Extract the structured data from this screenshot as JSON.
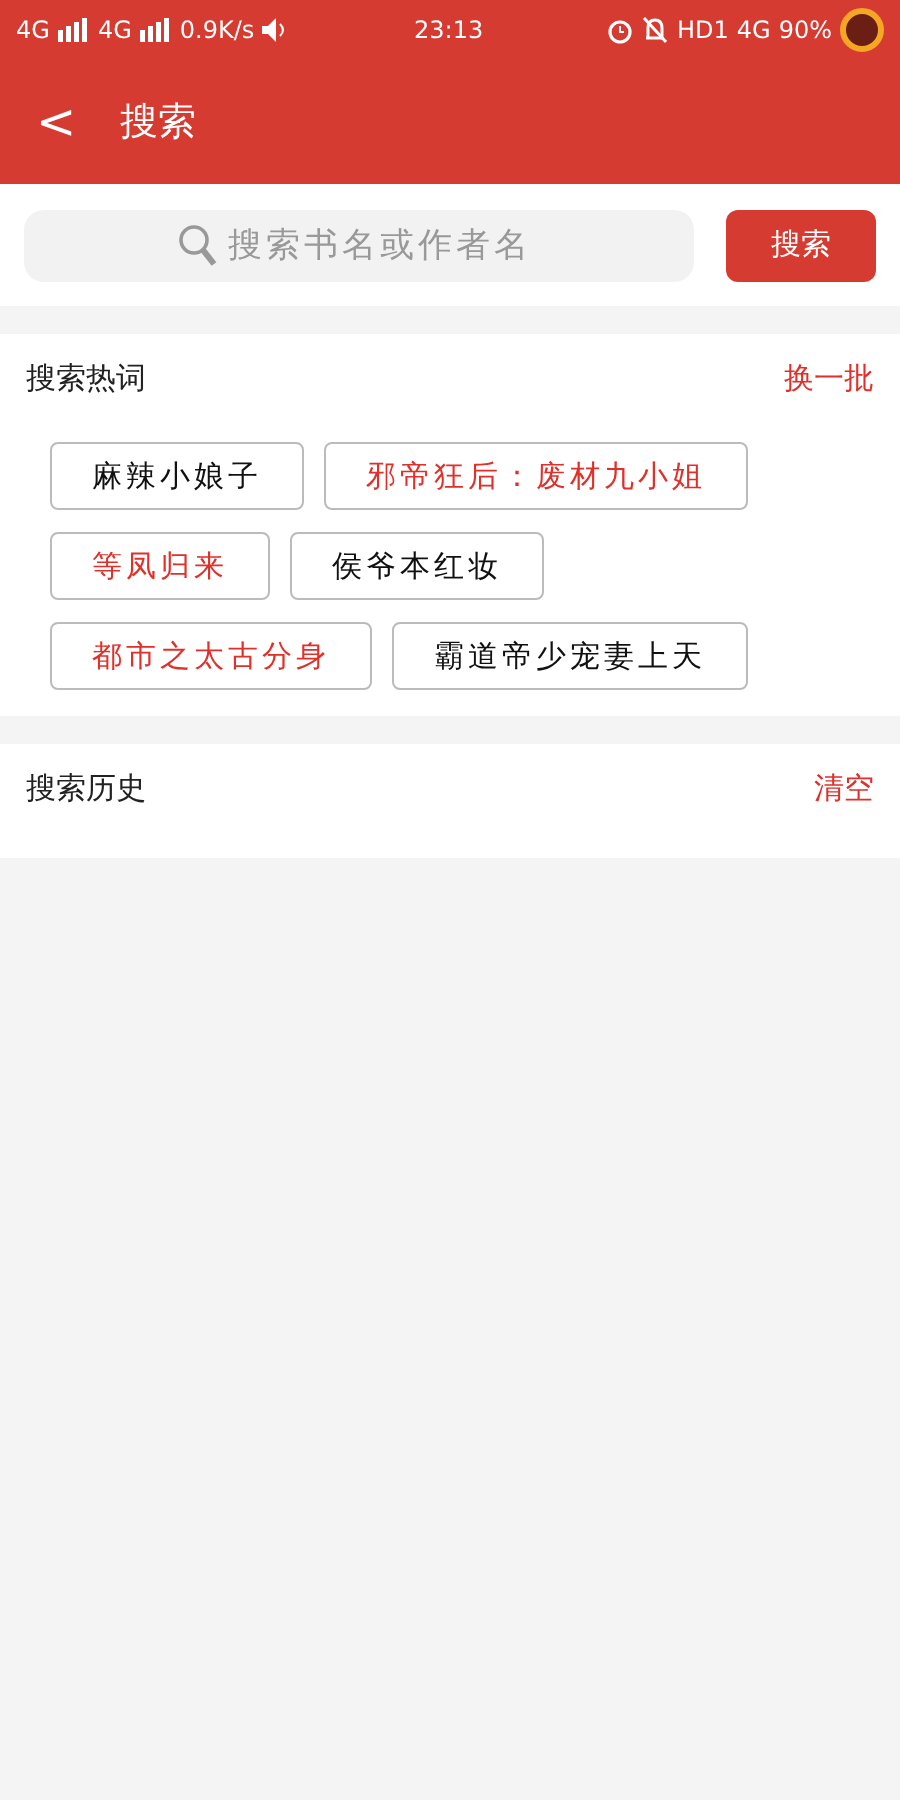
{
  "status_bar": {
    "network_1": "4G",
    "network_2": "4G",
    "speed": "0.9K/s",
    "time": "23:13",
    "hd": "HD1",
    "network_3": "4G",
    "battery": "90%"
  },
  "header": {
    "back": "<",
    "title": "搜索"
  },
  "search": {
    "placeholder": "搜索书名或作者名",
    "button": "搜索"
  },
  "hot": {
    "title": "搜索热词",
    "action": "换一批",
    "tags": [
      {
        "label": "麻辣小娘子",
        "color": "#111111"
      },
      {
        "label": "邪帝狂后：废材九小姐",
        "color": "#e0302a"
      },
      {
        "label": "等凤归来",
        "color": "#e0302a"
      },
      {
        "label": "侯爷本红妆",
        "color": "#111111"
      },
      {
        "label": "都市之太古分身",
        "color": "#e0302a"
      },
      {
        "label": "霸道帝少宠妻上天",
        "color": "#111111"
      }
    ]
  },
  "history": {
    "title": "搜索历史",
    "action": "清空"
  }
}
